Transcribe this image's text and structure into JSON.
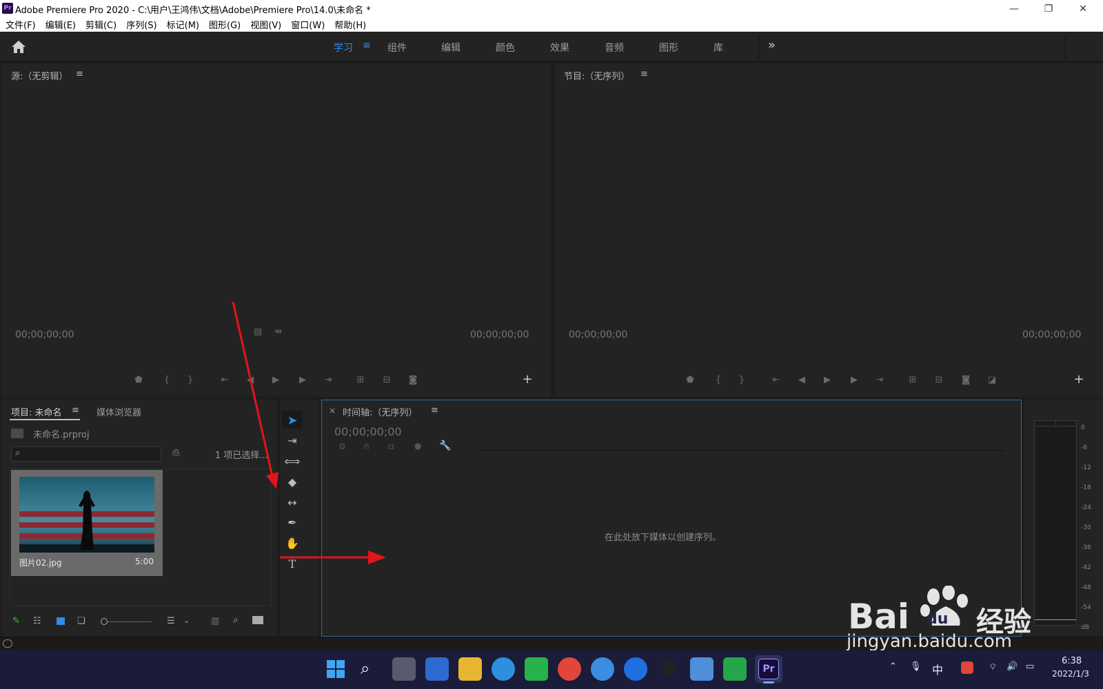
{
  "titlebar": {
    "app_badge": "Pr",
    "title": "Adobe Premiere Pro 2020 - C:\\用户\\王鸿伟\\文档\\Adobe\\Premiere Pro\\14.0\\未命名 *",
    "minimize": "—",
    "maximize": "❐",
    "close": "✕"
  },
  "menu": [
    "文件(F)",
    "编辑(E)",
    "剪辑(C)",
    "序列(S)",
    "标记(M)",
    "图形(G)",
    "视图(V)",
    "窗口(W)",
    "帮助(H)"
  ],
  "workspace": {
    "tabs": [
      "学习",
      "组件",
      "编辑",
      "颜色",
      "效果",
      "音频",
      "图形",
      "库"
    ],
    "active": "学习",
    "menu_icon": "≡",
    "overflow": "»"
  },
  "source_monitor": {
    "title": "源:（无剪辑）",
    "menu_icon": "≡",
    "tc_left": "00;00;00;00",
    "tc_right": "00;00;00;00",
    "add": "+"
  },
  "program_monitor": {
    "title": "节目:（无序列）",
    "menu_icon": "≡",
    "tc_left": "00;00;00;00",
    "tc_right": "00;00;00;00",
    "add": "+"
  },
  "project_panel": {
    "title": "项目: 未命名",
    "menu_icon": "≡",
    "tab2": "媒体浏览器",
    "file": "未命名.prproj",
    "selection": "1 项已选择...",
    "clip_name": "图片02.jpg",
    "clip_duration": "5:00"
  },
  "timeline": {
    "close": "×",
    "title": "时间轴:（无序列）",
    "menu_icon": "≡",
    "tc": "00;00;00;00",
    "empty_msg": "在此处放下媒体以创建序列。"
  },
  "meter": {
    "labels": [
      "0",
      "-6",
      "-12",
      "-18",
      "-24",
      "-30",
      "-36",
      "-42",
      "-48",
      "-54",
      "dB"
    ]
  },
  "taskbar": {
    "pr_label": "Pr",
    "ime": "中",
    "time": "6:38",
    "date": "2022/1/3"
  },
  "watermark": {
    "brand": "Bai",
    "brand2": "du",
    "cn": "经验",
    "url": "jingyan.baidu.com"
  },
  "colors": {
    "accent": "#2d8ceb",
    "panel": "#232323",
    "arrow": "#e3141a",
    "timeline_border": "#2d6ea8"
  }
}
